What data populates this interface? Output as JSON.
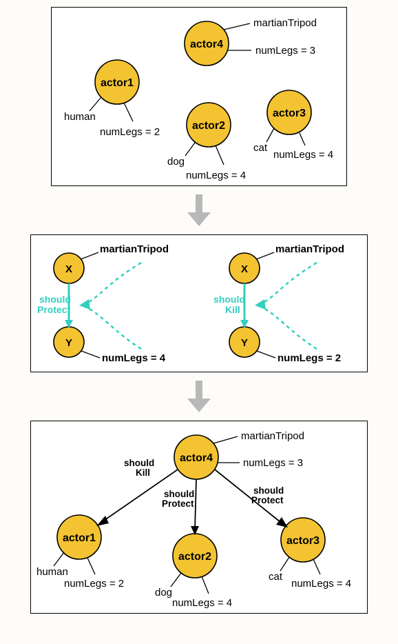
{
  "panel1": {
    "actor1": {
      "name": "actor1",
      "attr1": "human",
      "attr2": "numLegs = 2"
    },
    "actor2": {
      "name": "actor2",
      "attr1": "dog",
      "attr2": "numLegs = 4"
    },
    "actor3": {
      "name": "actor3",
      "attr1": "cat",
      "attr2": "numLegs = 4"
    },
    "actor4": {
      "name": "actor4",
      "attr1": "martianTripod",
      "attr2": "numLegs = 3"
    }
  },
  "panel2": {
    "left": {
      "x_label": "X",
      "y_label": "Y",
      "x_attr": "martianTripod",
      "y_attr": "numLegs = 4",
      "rel_line1": "should",
      "rel_line2": "Protect"
    },
    "right": {
      "x_label": "X",
      "y_label": "Y",
      "x_attr": "martianTripod",
      "y_attr": "numLegs = 2",
      "rel_line1": "should",
      "rel_line2": "Kill"
    }
  },
  "panel3": {
    "actor1": {
      "name": "actor1",
      "attr1": "human",
      "attr2": "numLegs = 2"
    },
    "actor2": {
      "name": "actor2",
      "attr1": "dog",
      "attr2": "numLegs = 4"
    },
    "actor3": {
      "name": "actor3",
      "attr1": "cat",
      "attr2": "numLegs = 4"
    },
    "actor4": {
      "name": "actor4",
      "attr1": "martianTripod",
      "attr2": "numLegs = 3"
    },
    "rel_a1": {
      "line1": "should",
      "line2": "Kill"
    },
    "rel_a2": {
      "line1": "should",
      "line2": "Protect"
    },
    "rel_a3": {
      "line1": "should",
      "line2": "Protect"
    }
  }
}
